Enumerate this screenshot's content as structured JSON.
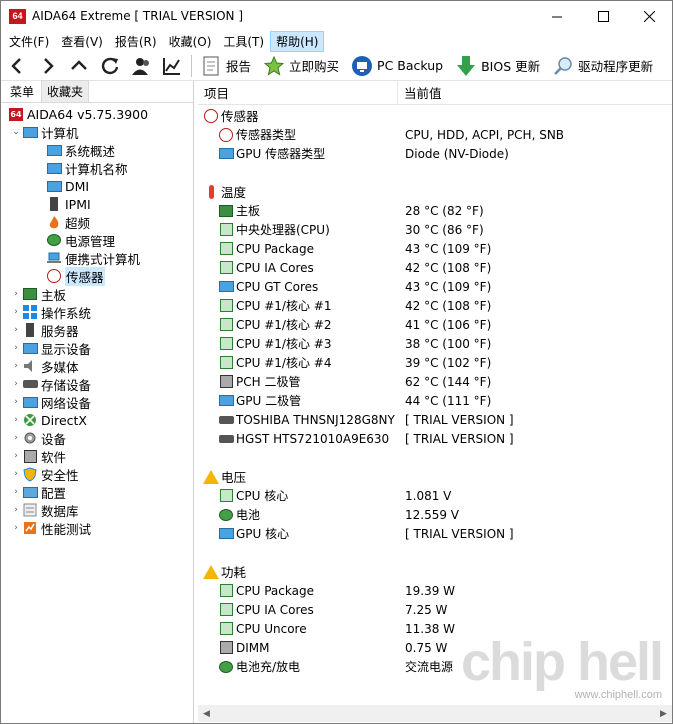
{
  "window": {
    "app_icon_text": "64",
    "title": "AIDA64 Extreme  [ TRIAL VERSION ]",
    "minimize": "—",
    "maximize": "☐",
    "close": "✕"
  },
  "menu": [
    {
      "label": "文件(F)"
    },
    {
      "label": "查看(V)"
    },
    {
      "label": "报告(R)"
    },
    {
      "label": "收藏(O)"
    },
    {
      "label": "工具(T)"
    },
    {
      "label": "帮助(H)"
    }
  ],
  "toolbar": {
    "report": "报告",
    "buy": "立即购买",
    "pc_backup": "PC Backup",
    "bios_update": "BIOS 更新",
    "driver_update": "驱动程序更新"
  },
  "tabs": {
    "menu": "菜单",
    "favorites": "收藏夹"
  },
  "tree": {
    "root": "AIDA64 v5.75.3900",
    "computer": "计算机",
    "computer_children": [
      "系统概述",
      "计算机名称",
      "DMI",
      "IPMI",
      "超频",
      "电源管理",
      "便携式计算机",
      "传感器"
    ],
    "categories": [
      "主板",
      "操作系统",
      "服务器",
      "显示设备",
      "多媒体",
      "存储设备",
      "网络设备",
      "DirectX",
      "设备",
      "软件",
      "安全性",
      "配置",
      "数据库",
      "性能测试"
    ]
  },
  "columns": {
    "item": "项目",
    "value": "当前值"
  },
  "sections": {
    "sensor": {
      "title": "传感器",
      "rows": [
        {
          "name": "传感器类型",
          "value": "CPU, HDD, ACPI, PCH, SNB",
          "icon": "gauge-icon"
        },
        {
          "name": "GPU 传感器类型",
          "value": "Diode  (NV-Diode)",
          "icon": "gpu-icon"
        }
      ]
    },
    "temperature": {
      "title": "温度",
      "rows": [
        {
          "name": "主板",
          "value": "28 °C  (82 °F)",
          "icon": "motherboard-icon"
        },
        {
          "name": "中央处理器(CPU)",
          "value": "30 °C  (86 °F)",
          "icon": "cpu-chip-icon"
        },
        {
          "name": "CPU Package",
          "value": "43 °C  (109 °F)",
          "icon": "cpu-chip-icon"
        },
        {
          "name": "CPU IA Cores",
          "value": "42 °C  (108 °F)",
          "icon": "cpu-chip-icon"
        },
        {
          "name": "CPU GT Cores",
          "value": "43 °C  (109 °F)",
          "icon": "gpu-icon"
        },
        {
          "name": "CPU #1/核心 #1",
          "value": "42 °C  (108 °F)",
          "icon": "cpu-chip-icon"
        },
        {
          "name": "CPU #1/核心 #2",
          "value": "41 °C  (106 °F)",
          "icon": "cpu-chip-icon"
        },
        {
          "name": "CPU #1/核心 #3",
          "value": "38 °C  (100 °F)",
          "icon": "cpu-chip-icon"
        },
        {
          "name": "CPU #1/核心 #4",
          "value": "39 °C  (102 °F)",
          "icon": "cpu-chip-icon"
        },
        {
          "name": "PCH 二极管",
          "value": "62 °C  (144 °F)",
          "icon": "pch-icon"
        },
        {
          "name": "GPU 二极管",
          "value": "44 °C  (111 °F)",
          "icon": "gpu-icon"
        },
        {
          "name": "TOSHIBA THNSNJ128G8NY",
          "value": "[ TRIAL VERSION ]",
          "icon": "disk-icon"
        },
        {
          "name": "HGST HTS721010A9E630",
          "value": "[ TRIAL VERSION ]",
          "icon": "disk-icon"
        }
      ]
    },
    "voltage": {
      "title": "电压",
      "rows": [
        {
          "name": "CPU 核心",
          "value": "1.081 V",
          "icon": "cpu-chip-icon"
        },
        {
          "name": "电池",
          "value": "12.559 V",
          "icon": "battery-icon"
        },
        {
          "name": "GPU 核心",
          "value": "[ TRIAL VERSION ]",
          "icon": "gpu-icon"
        }
      ]
    },
    "power": {
      "title": "功耗",
      "rows": [
        {
          "name": "CPU Package",
          "value": "19.39 W",
          "icon": "cpu-chip-icon"
        },
        {
          "name": "CPU IA Cores",
          "value": "7.25 W",
          "icon": "cpu-chip-icon"
        },
        {
          "name": "CPU Uncore",
          "value": "11.38 W",
          "icon": "cpu-chip-icon"
        },
        {
          "name": "DIMM",
          "value": "0.75 W",
          "icon": "memory-icon"
        },
        {
          "name": "电池充/放电",
          "value": "交流电源",
          "icon": "battery-icon"
        }
      ]
    }
  },
  "watermark": {
    "logo": "chip hell",
    "url": "www.chiphell.com"
  }
}
